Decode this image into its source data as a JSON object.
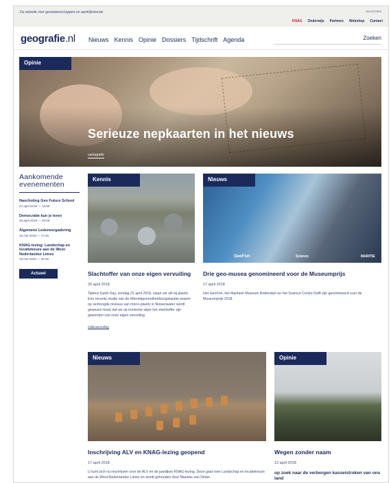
{
  "header": {
    "tagline": "De website voor geowetenschappen en aardrijkskunde",
    "login": "INLOGGEN",
    "top_links": [
      "KNAG",
      "Onderwijs",
      "Partners",
      "Webshop",
      "Contact"
    ]
  },
  "nav": {
    "logo_main": "geografie",
    "logo_suffix": ".nl",
    "items": [
      "Nieuws",
      "Kennis",
      "Opinie",
      "Dossiers",
      "Tijdschrift",
      "Agenda"
    ],
    "search": "Zoeken"
  },
  "hero": {
    "tag": "Opinie",
    "title": "Serieuze nepkaarten in het nieuws",
    "topic": "cartografie"
  },
  "sidebar": {
    "title": "Aankomende evenementen",
    "events": [
      {
        "title": "Nascholing Geo Future School",
        "date": "24 april 2018 — 13:00"
      },
      {
        "title": "Democratie kun je leren",
        "date": "25 april 2018 — 20:00"
      },
      {
        "title": "Algemene Ledenvergadering",
        "date": "16 mei 2018 — 17:45"
      },
      {
        "title": "KNAG-lezing: Landschap en locatiekeuze aan de West-Nederlandse Limes",
        "date": "16 mei 2018 — 20:15"
      }
    ],
    "button": "Actueel"
  },
  "cards": [
    {
      "tag": "Kennis",
      "title": "Slachtoffer van onze eigen vervuiling",
      "date": "20 april 2018",
      "body": "Tijdens Earth Day, zondag 22 april 2018, staan we stil bij plastic. Een recente studie van de Wereldgezondheidsorganisatie waarin op verhoogde niveaus van micro-plastic in flessenwater wordt gewezen toont dat we op ironische wijze het slachtoffer zijn geworden van onze eigen vervuiling.",
      "topic": "milieuvervuiling"
    },
    {
      "tag": "Nieuws",
      "title": "Drie geo-musea genomineerd voor de Museumprijs",
      "date": "17 april 2018",
      "body": "Het GeoFort, het Maritiem Museum Rotterdam en het Science Centre Delft zijn genomineerd voor de Museumprijs 2018.",
      "image_labels": [
        "GeoFort",
        "Science",
        "MARITIE"
      ]
    },
    {
      "tag": "Nieuws",
      "title": "Inschrijving ALV en KNAG-lezing geopend",
      "date": "17 april 2018",
      "body": "U kunt zich nu inschrijven voor de ALV en de jaarlijkse KNAG-lezing. Deze gaat over Landschap en locatiekeuze aan de West-Nederlandse Limes en wordt gehouden door Marieke van Dinter."
    },
    {
      "tag": "Opinie",
      "title": "Wegen zonder naam",
      "date": "13 april 2018",
      "subtitle": "op zoek naar de verborgen kasseistroken van ons land"
    }
  ]
}
